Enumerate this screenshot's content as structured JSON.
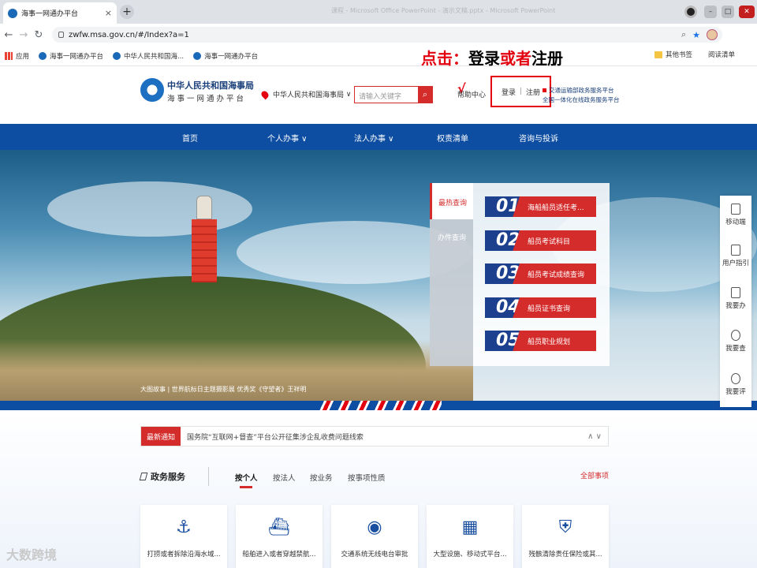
{
  "browser": {
    "tab_title": "海事一网通办平台",
    "tab_close": "×",
    "new_tab": "+",
    "ghost_window_title": "课程 - Microsoft Office PowerPoint - 演示文稿.pptx - Microsoft PowerPoint",
    "url": "zwfw.msa.gov.cn/#/Index?a=1",
    "bookmarks": [
      "应用",
      "海事一网通办平台",
      "中华人民共和国海...",
      "海事一网通办平台"
    ],
    "bookmarks_right": [
      "其他书签",
      "阅读清单"
    ]
  },
  "annotation": {
    "part1": "点击：登录",
    "part2": "或者",
    "part3": "注册"
  },
  "header": {
    "site_name": "中华人民共和国海事局",
    "site_sub": "海事一网通办平台",
    "location": "中华人民共和国海事局",
    "search_placeholder": "请输入关键字",
    "help": "帮助中心",
    "check_mark": "√",
    "login": "登录",
    "separator": "|",
    "register": "注册",
    "platform_line1": "交通运输部政务服务平台",
    "platform_line2": "全国一体化在线政务服务平台"
  },
  "nav": {
    "home": "首页",
    "personal": "个人办事",
    "legal": "法人办事",
    "rights": "权责清单",
    "consult": "咨询与投诉"
  },
  "hero": {
    "caption": "大图故事 | 世界航标日主题摄影展 优秀奖《守望者》王祥明",
    "tab_hot": "最热查询",
    "tab_handle": "办件查询",
    "items": [
      {
        "num": "01",
        "label": "海船船员适任考..."
      },
      {
        "num": "02",
        "label": "船员考试科目"
      },
      {
        "num": "03",
        "label": "船员考试成绩查询"
      },
      {
        "num": "04",
        "label": "船员证书查询"
      },
      {
        "num": "05",
        "label": "船员职业规划"
      }
    ]
  },
  "sidebar": [
    "移动端",
    "用户指引",
    "我要办",
    "我要查",
    "我要评"
  ],
  "notice": {
    "tag": "最新通知",
    "text": "国务院“互联网+督查”平台公开征集涉企乱收费问题线索",
    "arrows": "∧ ∨"
  },
  "services": {
    "title": "政务服务",
    "tabs": [
      "按个人",
      "按法人",
      "按业务",
      "按事项性质"
    ],
    "all": "全部事项",
    "cards": [
      {
        "icon": "⚓",
        "label": "打捞或者拆除沿海水域..."
      },
      {
        "icon": "⛴",
        "label": "船舶进入或者穿越禁航..."
      },
      {
        "icon": "◉",
        "label": "交通系统无线电台审批"
      },
      {
        "icon": "▦",
        "label": "大型设施、移动式平台..."
      },
      {
        "icon": "⛨",
        "label": "残骸清除责任保险或其..."
      }
    ]
  },
  "watermark": "大数跨境",
  "colors": {
    "primary_blue": "#0e4ea2",
    "accent_red": "#d42b2b",
    "annotation_red": "#e3000f"
  }
}
